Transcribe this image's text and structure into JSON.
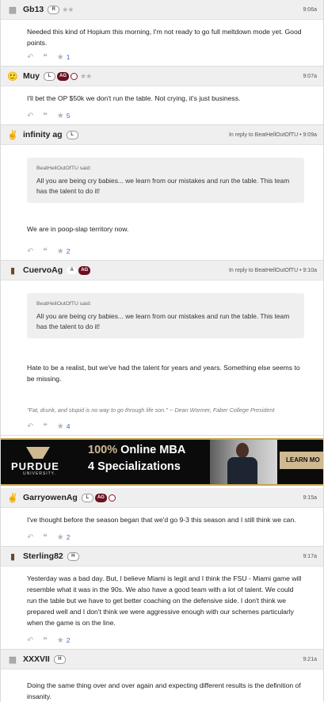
{
  "posts": [
    {
      "username": "Gb13",
      "badges": [
        "R"
      ],
      "stars": "★★",
      "time": "9:06a",
      "body": "Needed this kind of Hopium this morning, I'm not ready to go full meltdown mode yet. Good points.",
      "likes": "1"
    },
    {
      "username": "Muy",
      "badges": [
        "L",
        "AG"
      ],
      "stars": "★★",
      "time": "9:07a",
      "body": "I'll bet the OP $50k we don't run the table. Not crying, it's just business.",
      "likes": "5"
    },
    {
      "username": "infinity ag",
      "badges": [
        "L"
      ],
      "time": "In reply to BeatHellOutOfTU • 9:09a",
      "quote_author": "BeatHellOutOfTU said:",
      "quote": "All you are being cry babies... we learn from our mistakes and run the table. This team has the talent to do it!",
      "body": "We are in poop-slap territory now.",
      "likes": "2"
    },
    {
      "username": "CuervoAg",
      "badges": [
        "A",
        "AG"
      ],
      "time": "In reply to BeatHellOutOfTU • 9:10a",
      "quote_author": "BeatHellOutOfTU said:",
      "quote": "All you are being cry babies... we learn from our mistakes and run the table. This team has the talent to do it!",
      "body": "Hate to be a realist, but we've had the talent for years and years. Something else seems to be missing.",
      "signature": "\"Fat, drunk, and stupid is no way to go through life son.\" -- Dean Wormer, Faber College President",
      "likes": "4"
    },
    {
      "username": "GarryowenAg",
      "badges": [
        "L",
        "AG"
      ],
      "time": "9:15a",
      "body": "I've thought before the season began that we'd go 9-3 this season and I still think we can.",
      "likes": "2"
    },
    {
      "username": "Sterling82",
      "badges": [
        "H"
      ],
      "time": "9:17a",
      "body": "Yesterday was a bad day. But, I believe Miami is legit and I think the FSU - Miami game will resemble what it was in the 90s. We also have a good team with a lot of talent. We could run the table but we have to get better coaching on the defensive side. I don't think we prepared well and I don't think we were aggressive enough with our schemes particularly when the game is on the line.",
      "likes": "2"
    },
    {
      "username": "XXXVII",
      "badges": [
        "H"
      ],
      "time": "9:21a",
      "body": "Doing the same thing over and over again and expecting different results is the definition of insanity."
    }
  ],
  "ad": {
    "brand": "PURDUE",
    "brand_sub": "UNIVERSITY.",
    "headline_highlight": "100%",
    "headline_rest": " Online MBA",
    "subline": "4 Specializations",
    "cta": "LEARN MO"
  },
  "colors": {
    "header_bg": "#efefef",
    "ag_badge": "#6a1020",
    "like_count": "#3b6fc2",
    "ad_gold": "#cfb991"
  }
}
